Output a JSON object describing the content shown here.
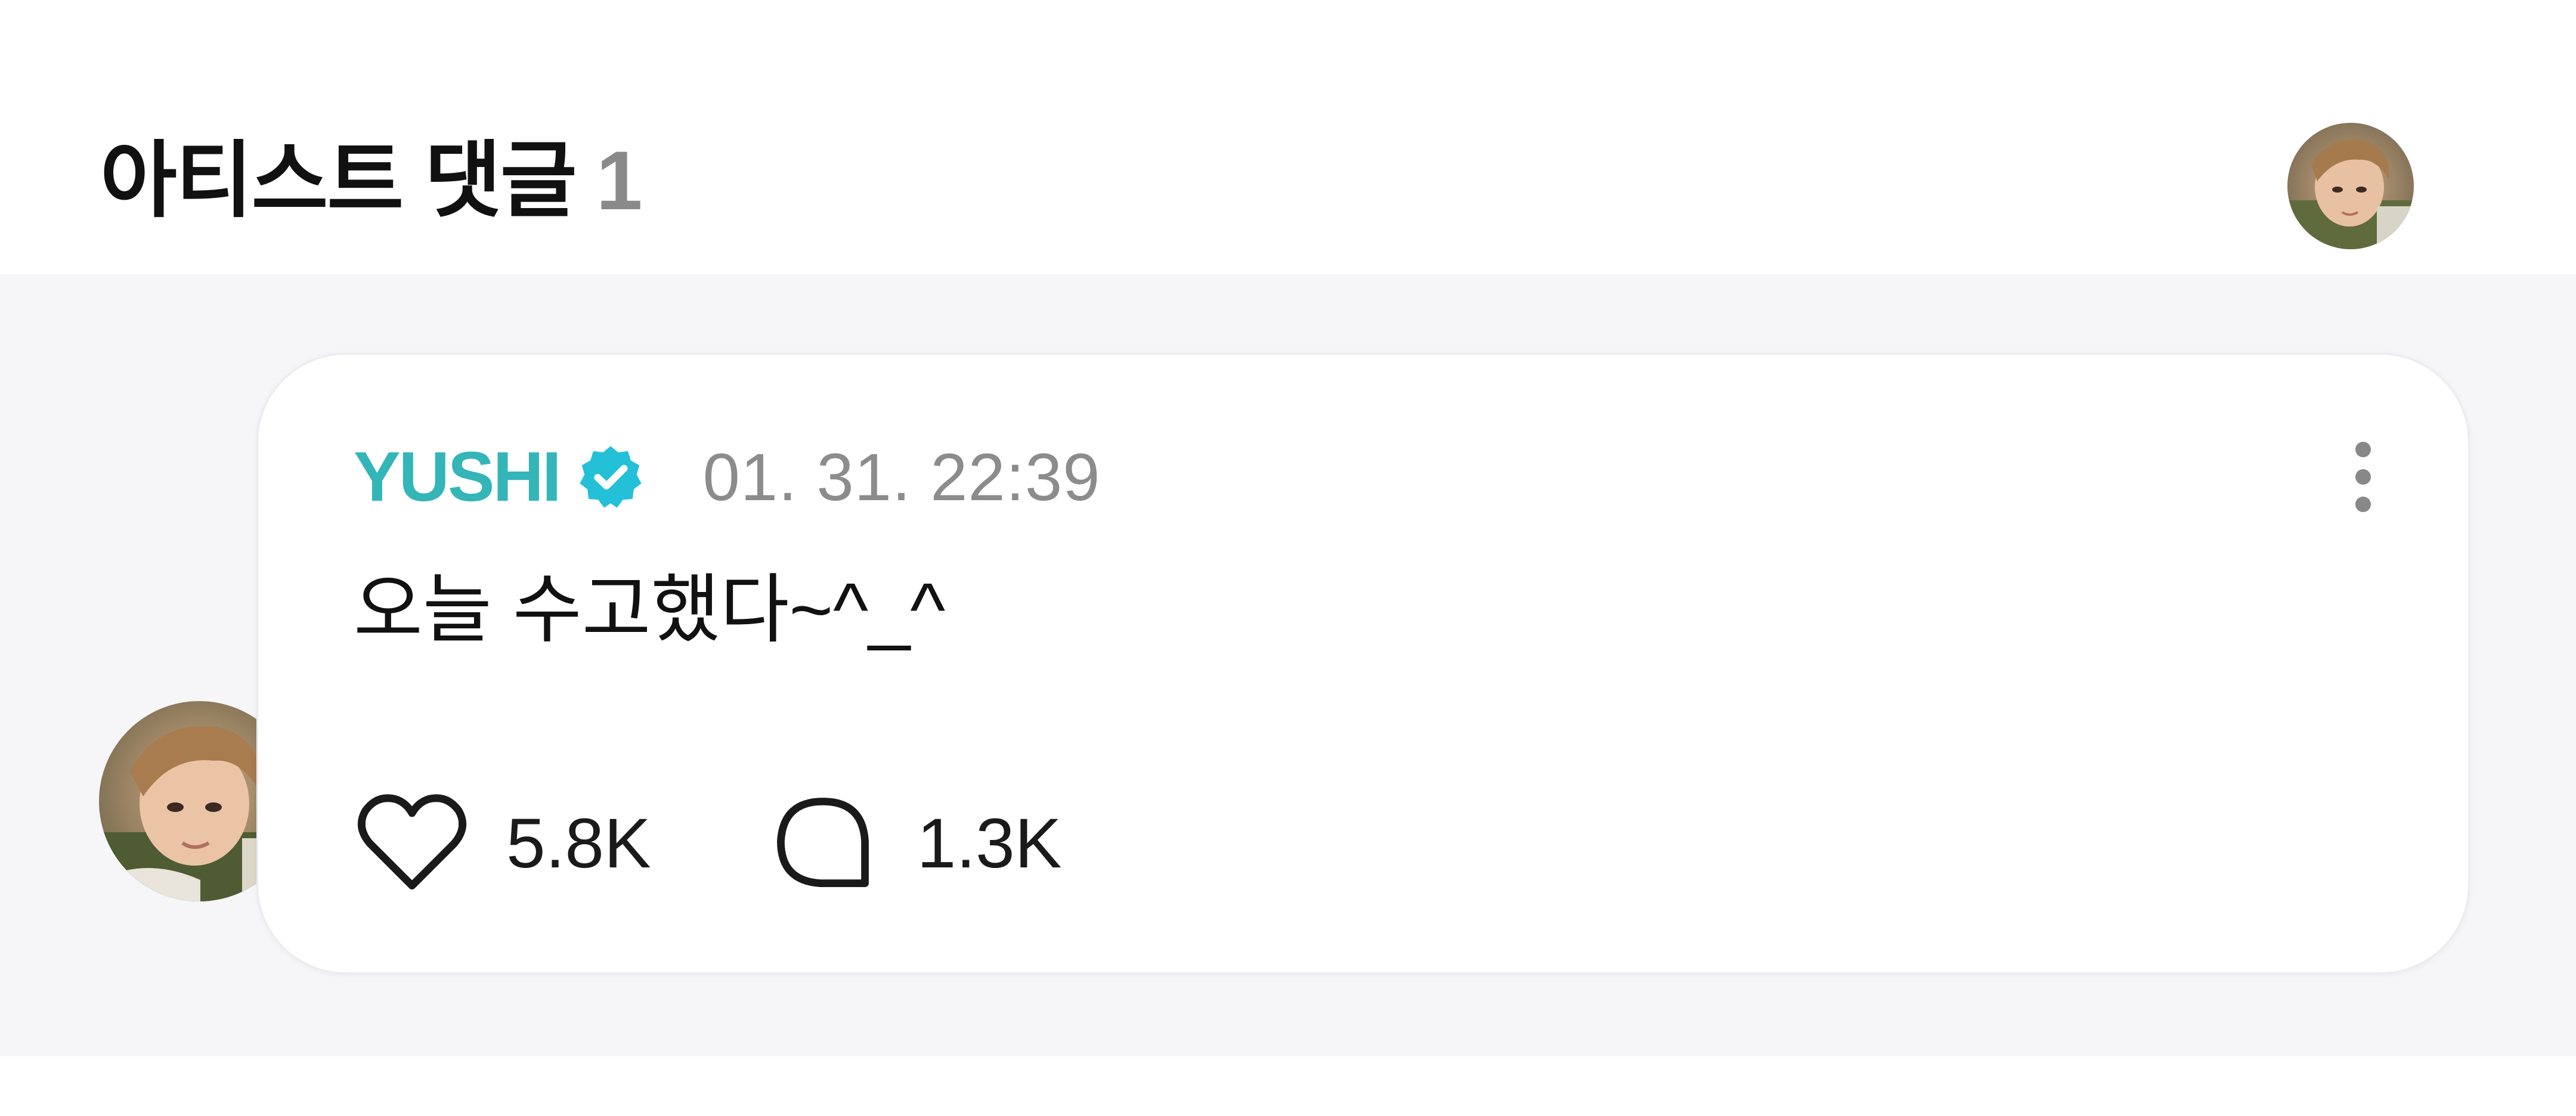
{
  "header": {
    "title": "아티스트 댓글",
    "count": "1"
  },
  "comment": {
    "author": "YUSHI",
    "verified_icon": "verified-badge-icon",
    "timestamp": "01. 31. 22:39",
    "text": "오늘 수고했다~^_^",
    "likes": "5.8K",
    "replies": "1.3K"
  },
  "colors": {
    "author": "#34b5b8",
    "verified": "#24c0d8",
    "section_background": "#f6f6f8",
    "timestamp": "#8c8c8c"
  }
}
